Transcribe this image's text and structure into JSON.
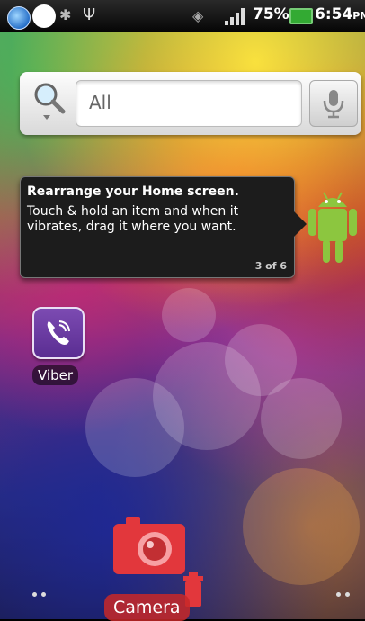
{
  "status_bar": {
    "battery_percent": "75%",
    "time": "6:54",
    "ampm": "PM"
  },
  "search": {
    "field_text": "All"
  },
  "tip": {
    "title": "Rearrange your Home screen.",
    "body": "Touch & hold an item and when it vibrates, drag it where you want.",
    "page": "3 of 6"
  },
  "apps": {
    "viber_label": "Viber",
    "camera_label": "Camera"
  },
  "colors": {
    "viber": "#6a3aa2",
    "camera": "#e2373c",
    "android": "#8cc63f"
  }
}
